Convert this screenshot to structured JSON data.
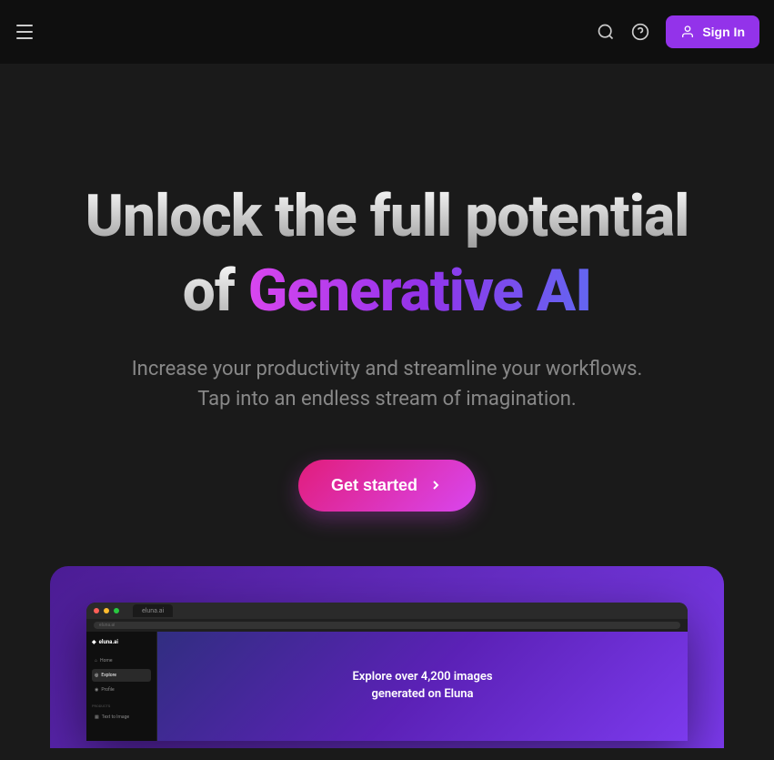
{
  "header": {
    "signin_label": "Sign In"
  },
  "hero": {
    "title_line1": "Unlock the full potential",
    "title_of": "of ",
    "title_gradient": "Generative AI",
    "subtitle_line1": "Increase your productivity and streamline your workflows.",
    "subtitle_line2": "Tap into an endless stream of imagination.",
    "cta_label": "Get started"
  },
  "preview": {
    "browser": {
      "tab_label": "eluna.ai",
      "url": "eluna.ai",
      "sidebar": {
        "logo": "eluna.ai",
        "items": [
          {
            "label": "Home",
            "active": false
          },
          {
            "label": "Explore",
            "active": true
          },
          {
            "label": "Profile",
            "active": false
          }
        ],
        "section_label": "Products",
        "products": [
          {
            "label": "Text to Image"
          }
        ]
      },
      "main_text_line1": "Explore over 4,200 images",
      "main_text_line2": "generated on Eluna"
    }
  }
}
